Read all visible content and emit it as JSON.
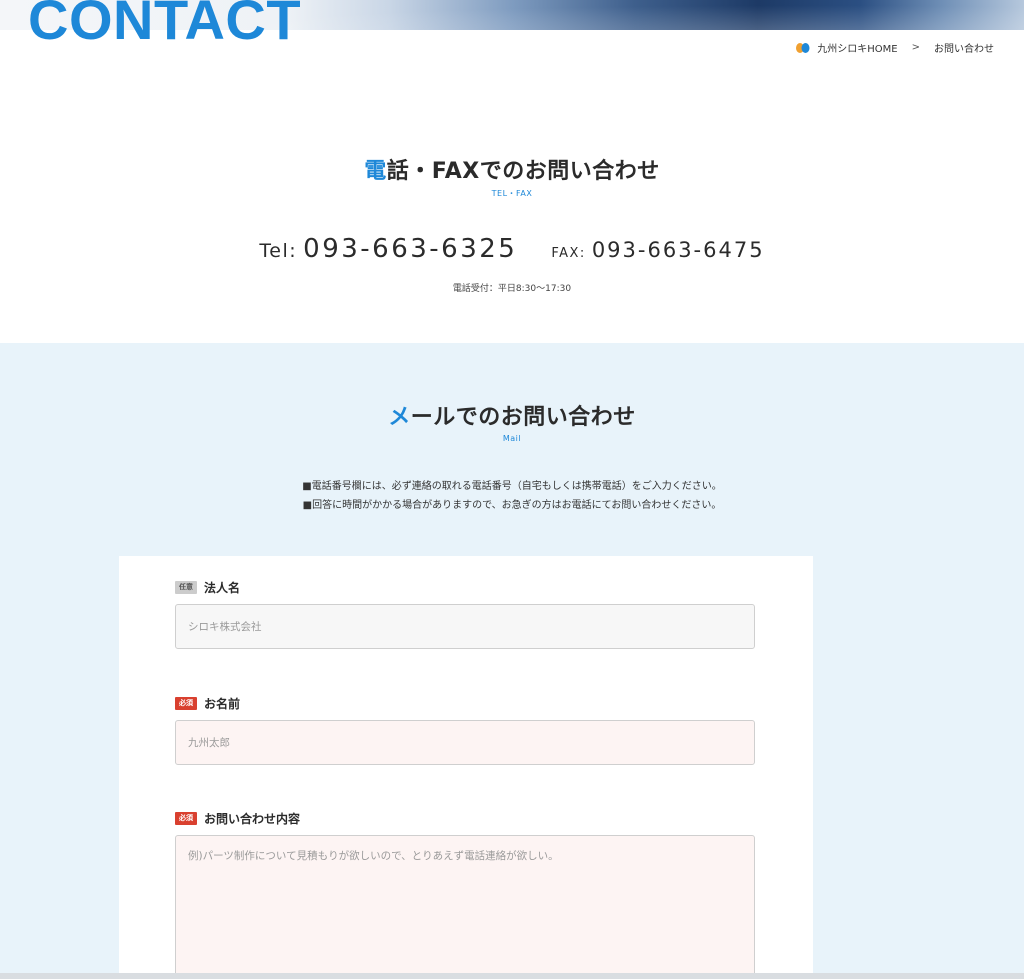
{
  "hero": {
    "title": "CONTACT"
  },
  "breadcrumb": {
    "home": "九州シロキHOME",
    "separator": ">",
    "current": "お問い合わせ"
  },
  "tel_section": {
    "title_accent": "電",
    "title_rest": "話・FAXでのお問い合わせ",
    "subtitle": "TEL・FAX",
    "tel_label": "Tel:",
    "tel_number": "093-663-6325",
    "fax_label": "FAX:",
    "fax_number": "093-663-6475",
    "hours": "電話受付：平日8:30～17:30"
  },
  "mail_section": {
    "title_accent": "メ",
    "title_rest": "ールでのお問い合わせ",
    "subtitle": "Mail",
    "notes": [
      "■電話番号欄には、必ず連絡の取れる電話番号（自宅もしくは携帯電話）をご入力ください。",
      "■回答に時間がかかる場合がありますので、お急ぎの方はお電話にてお問い合わせください。"
    ]
  },
  "form": {
    "company": {
      "tag": "任意",
      "label": "法人名",
      "placeholder": "シロキ株式会社"
    },
    "name": {
      "tag": "必須",
      "label": "お名前",
      "placeholder": "九州太郎"
    },
    "inquiry": {
      "tag": "必須",
      "label": "お問い合わせ内容",
      "placeholder": "例)パーツ制作について見積もりが欲しいので、とりあえず電話連絡が欲しい。"
    }
  },
  "colors": {
    "accent": "#1e88d8",
    "required": "#d9402f",
    "section_bg": "#e8f3fa"
  },
  "icons": {
    "breadcrumb_logo": "brand-logo-icon"
  }
}
